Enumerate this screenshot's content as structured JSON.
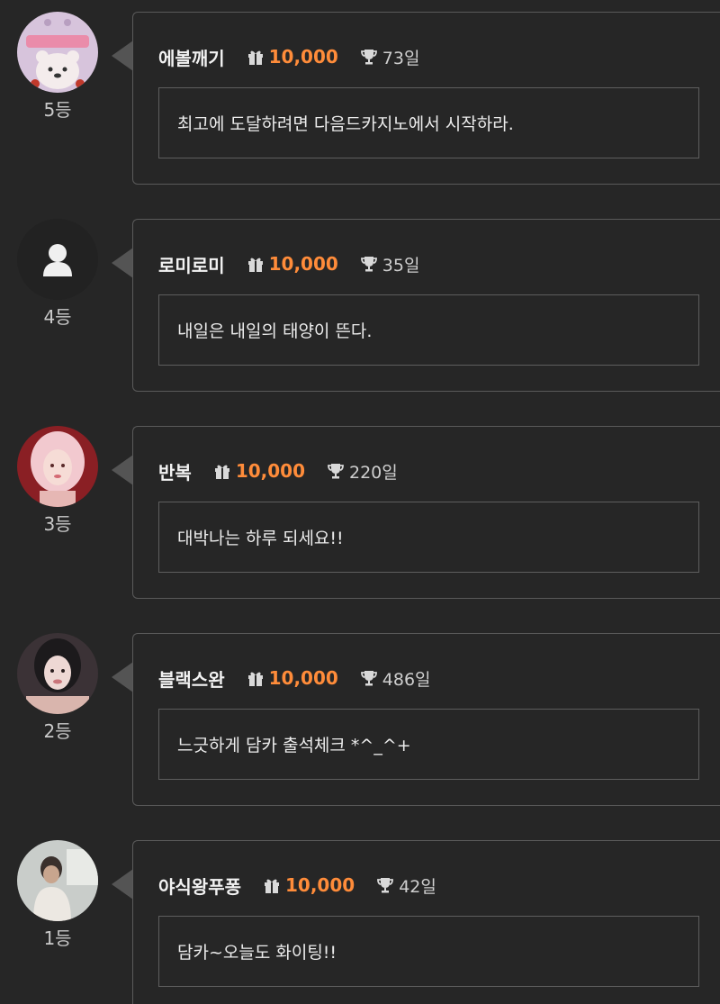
{
  "entries": [
    {
      "rank": "5등",
      "nickname": "에볼깨기",
      "points": "10,000",
      "days": "73일",
      "message": "최고에 도달하려면 다음드카지노에서 시작하라.",
      "avatar_icon": "pink-bear-avatar"
    },
    {
      "rank": "4등",
      "nickname": "로미로미",
      "points": "10,000",
      "days": "35일",
      "message": "내일은 내일의 태양이 뜬다.",
      "avatar_icon": "default-user-avatar"
    },
    {
      "rank": "3등",
      "nickname": "반복",
      "points": "10,000",
      "days": "220일",
      "message": "대박나는 하루 되세요!!",
      "avatar_icon": "photo-avatar"
    },
    {
      "rank": "2등",
      "nickname": "블랙스완",
      "points": "10,000",
      "days": "486일",
      "message": "느긋하게 담카 출석체크 *^_^+",
      "avatar_icon": "photo-avatar"
    },
    {
      "rank": "1등",
      "nickname": "야식왕푸퐁",
      "points": "10,000",
      "days": "42일",
      "message": "담카~오늘도 화이팅!!",
      "avatar_icon": "photo-avatar"
    }
  ],
  "colors": {
    "background": "#262626",
    "points": "#ff8c3a",
    "border": "#5a5a5a"
  }
}
